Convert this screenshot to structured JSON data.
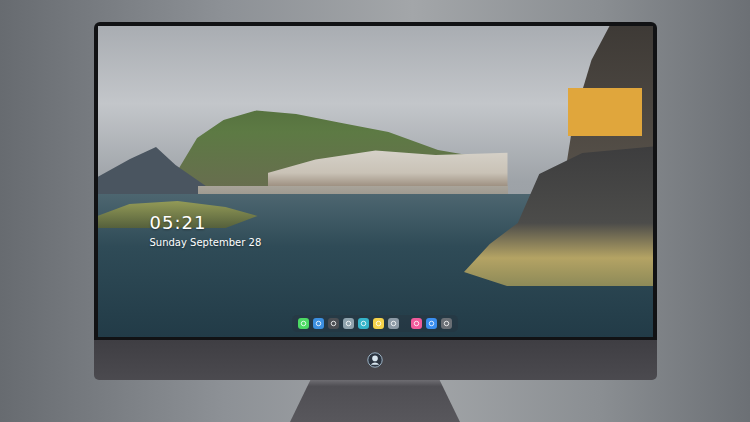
{
  "lock_screen": {
    "time": "05:21",
    "date": "Sunday September 28"
  },
  "dock": {
    "groups": [
      {
        "items": [
          {
            "color": "#4cd964"
          },
          {
            "color": "#3b8fe0"
          },
          {
            "color": "#4a4d52"
          },
          {
            "color": "#8fa3ad"
          },
          {
            "color": "#35b4c9"
          },
          {
            "color": "#f5d24a"
          },
          {
            "color": "#8c9aa6"
          }
        ]
      },
      {
        "items": [
          {
            "color": "#f05a9a"
          },
          {
            "color": "#3a8ef0"
          },
          {
            "color": "#6a6f75"
          }
        ]
      }
    ]
  }
}
